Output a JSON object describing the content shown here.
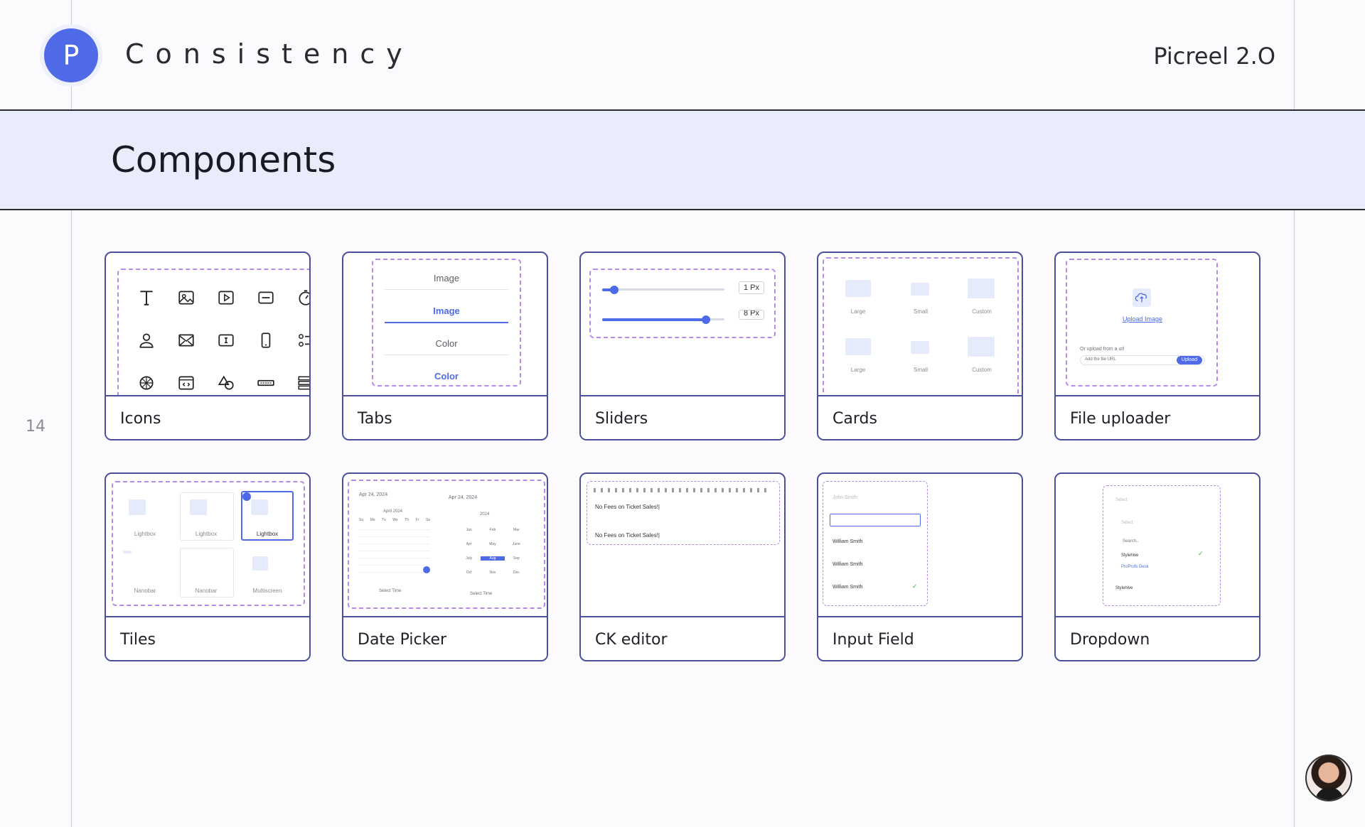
{
  "header": {
    "logo_letter": "P",
    "brand": "Consistency",
    "version": "Picreel 2.O"
  },
  "section": {
    "title": "Components"
  },
  "page_number": "14",
  "cards": [
    {
      "label": "Icons"
    },
    {
      "label": "Tabs",
      "tabs": [
        "Image",
        "Image",
        "Color",
        "Color"
      ]
    },
    {
      "label": "Sliders",
      "values": [
        "1 Px",
        "8 Px"
      ],
      "levels": [
        0.1,
        0.85
      ]
    },
    {
      "label": "Cards",
      "sizes": [
        "Large",
        "Small",
        "Custom",
        "Large",
        "Small",
        "Custom"
      ]
    },
    {
      "label": "File uploader",
      "upload_link": "Upload Image",
      "url_hint": "Or upload from a url",
      "url_placeholder": "Add the file URL",
      "upload_button": "Upload"
    },
    {
      "label": "Tiles",
      "tile_labels": [
        "Lightbox",
        "Lightbox",
        "Lightbox",
        "Nanobar",
        "Nanobar",
        "Multiscreen"
      ]
    },
    {
      "label": "Date Picker",
      "date1": "Apr 24, 2024",
      "date2": "Apr 24, 2024",
      "month": "April 2024",
      "year": "2024",
      "select_time": "Select Time",
      "weekdays": [
        "Su",
        "Mo",
        "Tu",
        "We",
        "Th",
        "Fr",
        "Sa"
      ],
      "months": [
        "Jan",
        "Feb",
        "Mar",
        "Apr",
        "May",
        "June",
        "July",
        "Aug",
        "Sep",
        "Oct",
        "Nov",
        "Dec"
      ]
    },
    {
      "label": "CK editor",
      "text1": "No Fees on Ticket Sales!|",
      "text2": "No Fees on Ticket Sales!|"
    },
    {
      "label": "Input Field",
      "placeholder": "John Smith",
      "values": [
        "William Smith",
        "William Smith",
        "William Smith"
      ]
    },
    {
      "label": "Dropdown",
      "placeholder1": "Select",
      "placeholder2": "Select",
      "search": "Search..",
      "options": [
        "Stylehive",
        "ProProfs Desk"
      ],
      "selected": "Stylehive"
    }
  ]
}
